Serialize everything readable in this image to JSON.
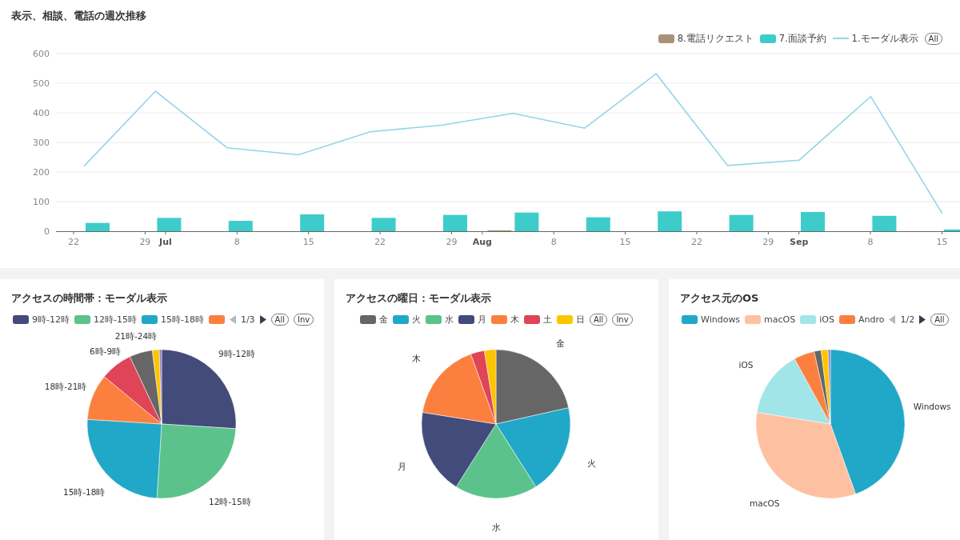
{
  "weekly_card": {
    "title": "表示、相談、電話の週次推移",
    "all_button": "All",
    "x_axis_labels": [
      {
        "label": "22",
        "month": false
      },
      {
        "label": "29",
        "month": false
      },
      {
        "label": "Jul",
        "month": true
      },
      {
        "label": "8",
        "month": false
      },
      {
        "label": "15",
        "month": false
      },
      {
        "label": "22",
        "month": false
      },
      {
        "label": "29",
        "month": false
      },
      {
        "label": "Aug",
        "month": true
      },
      {
        "label": "8",
        "month": false
      },
      {
        "label": "15",
        "month": false
      },
      {
        "label": "22",
        "month": false
      },
      {
        "label": "29",
        "month": false
      },
      {
        "label": "Sep",
        "month": true
      },
      {
        "label": "8",
        "month": false
      },
      {
        "label": "15",
        "month": false
      }
    ],
    "chart_data": {
      "type": "bar",
      "stacked": false,
      "grid": true,
      "categories": [
        null,
        null,
        null,
        null,
        null,
        null,
        null,
        null,
        null,
        null,
        null,
        null,
        null
      ],
      "ylim": [
        0,
        600
      ],
      "yticks": [
        0,
        100,
        200,
        300,
        400,
        500,
        600
      ],
      "series": [
        {
          "name": "8.電話リクエスト",
          "type": "bar",
          "color": "#a89277",
          "values": [
            0,
            0,
            0,
            0,
            0,
            0,
            3,
            0,
            0,
            0,
            0,
            0,
            0
          ]
        },
        {
          "name": "7.面談予約",
          "type": "bar",
          "color": "#3ecccb",
          "values": [
            28,
            45,
            35,
            57,
            45,
            55,
            63,
            47,
            67,
            55,
            65,
            52,
            6
          ]
        },
        {
          "name": "1.モーダル表示",
          "type": "line",
          "color": "#94d5e6",
          "values": [
            220,
            473,
            282,
            258,
            336,
            358,
            398,
            348,
            532,
            222,
            240,
            455,
            60
          ]
        }
      ]
    }
  },
  "pie_cards": [
    {
      "title": "アクセスの時間帯：モーダル表示",
      "legend": [
        {
          "label": "9時-12時",
          "color": "#434b7a"
        },
        {
          "label": "12時-15時",
          "color": "#5bc28b"
        },
        {
          "label": "15時-18時",
          "color": "#21a7c8"
        },
        {
          "color": "#fb8040"
        }
      ],
      "pager": {
        "text": "1/3",
        "prev_disabled": true,
        "next_disabled": false
      },
      "buttons": [
        "All",
        "Inv"
      ],
      "chart_data": {
        "type": "pie",
        "categories": [
          "9時-12時",
          "12時-15時",
          "15時-18時",
          "18時-21時",
          "6時-9時",
          "21時-24時",
          null,
          null
        ],
        "values": [
          26,
          25,
          25,
          10,
          7,
          5,
          1.5,
          0.5
        ],
        "colors": [
          "#434b7a",
          "#5bc28b",
          "#21a7c8",
          "#fb8040",
          "#e04457",
          "#666666",
          "#fdc500",
          "#a07cc5"
        ]
      }
    },
    {
      "title": "アクセスの曜日：モーダル表示",
      "legend": [
        {
          "label": "金",
          "color": "#666666"
        },
        {
          "label": "火",
          "color": "#21a7c8"
        },
        {
          "label": "水",
          "color": "#5bc28b"
        },
        {
          "label": "月",
          "color": "#434b7a"
        },
        {
          "label": "木",
          "color": "#fb8040"
        },
        {
          "label": "土",
          "color": "#e04457"
        },
        {
          "label": "日",
          "color": "#fdc500"
        }
      ],
      "buttons": [
        "All",
        "Inv"
      ],
      "chart_data": {
        "type": "pie",
        "categories": [
          "金",
          "火",
          "水",
          "月",
          "木",
          null,
          null
        ],
        "values": [
          21.5,
          19.5,
          18,
          18.5,
          17,
          3,
          2.5
        ],
        "colors": [
          "#666666",
          "#21a7c8",
          "#5bc28b",
          "#434b7a",
          "#fb8040",
          "#e04457",
          "#fdc500"
        ]
      }
    },
    {
      "title": "アクセス元のOS",
      "legend": [
        {
          "label": "Windows",
          "color": "#21a7c8"
        },
        {
          "label": "macOS",
          "color": "#fdc1a1"
        },
        {
          "label": "iOS",
          "color": "#a1e5e8"
        },
        {
          "label": "Andro",
          "color": "#fb8040"
        }
      ],
      "pager": {
        "text": "1/2",
        "prev_disabled": true,
        "next_disabled": false
      },
      "buttons": [
        "All"
      ],
      "chart_data": {
        "type": "pie",
        "categories": [
          "Windows",
          "macOS",
          "iOS",
          null,
          null,
          null,
          null
        ],
        "values": [
          44.5,
          33,
          14.5,
          4.5,
          1.5,
          1.5,
          0.5
        ],
        "colors": [
          "#21a7c8",
          "#fdc1a1",
          "#a1e5e8",
          "#fb8040",
          "#666666",
          "#fdc500",
          "#a07cc5"
        ]
      }
    }
  ]
}
